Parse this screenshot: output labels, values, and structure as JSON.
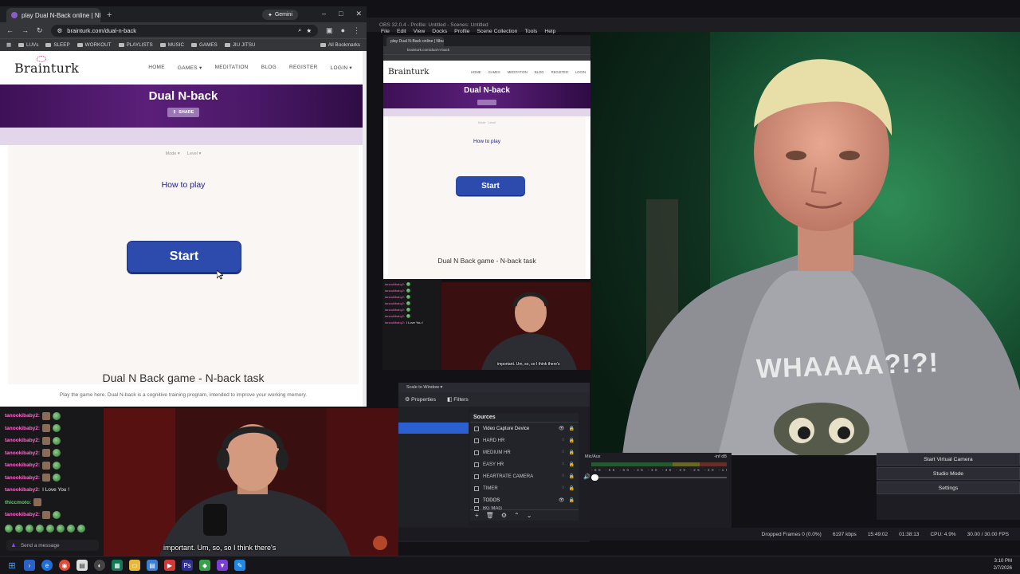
{
  "browser": {
    "tab_title": "play Dual N-Back online | Nbu",
    "gemini_label": "Gemini",
    "url": "brainturk.com/dual-n-back",
    "bookmarks": [
      "LUVs",
      "SLEEP",
      "WORKOUT",
      "PLAYLISTS",
      "MUSIC",
      "GAMES",
      "JIU JITSU"
    ],
    "all_bookmarks": "All Bookmarks"
  },
  "site": {
    "logo": "Brainturk",
    "nav": [
      "HOME",
      "GAMES",
      "MEDITATION",
      "BLOG",
      "REGISTER",
      "LOGIN"
    ],
    "title": "Dual N-back",
    "share": "SHARE",
    "mode_label": "Mode",
    "level_label": "Level",
    "how_to_play": "How to play",
    "start": "Start",
    "section_title": "Dual N Back game - N-back task",
    "section_text": "Play the game here. Dual N-back is a cognitive training program, intended to improve your working memory."
  },
  "preview": {
    "app_title": "OBS 32.0.4 - Profile: Untitled - Scenes: Untitled",
    "menu": [
      "File",
      "Edit",
      "View",
      "Docks",
      "Profile",
      "Scene Collection",
      "Tools",
      "Help"
    ],
    "tab_title": "play Dual N-Back online | Nbu",
    "url": "brainturk.com/dual-n-back",
    "logo": "Brainturk",
    "title": "Dual N-back",
    "how_to_play": "How to play",
    "start": "Start",
    "section_title": "Dual N Back game - N-back task"
  },
  "guest_subtitle": "important. Um, so, so I think there's",
  "streamer_shirt": "WHAAAA?!?!",
  "chat": {
    "messages": [
      {
        "user": "tanookibaby2:",
        "text": ""
      },
      {
        "user": "tanookibaby2:",
        "text": ""
      },
      {
        "user": "tanookibaby2:",
        "text": ""
      },
      {
        "user": "tanookibaby2:",
        "text": ""
      },
      {
        "user": "tanookibaby2:",
        "text": ""
      },
      {
        "user": "tanookibaby2:",
        "text": ""
      },
      {
        "user": "tanookibaby2:",
        "text": "I Love You !"
      },
      {
        "user": "thiccmoto:",
        "text": ""
      },
      {
        "user": "tanookibaby2:",
        "text": ""
      }
    ],
    "placeholder": "Send a message"
  },
  "obs": {
    "scale_label": "Scale to Window",
    "properties": "Properties",
    "filters": "Filters",
    "sources_title": "Sources",
    "sources": [
      "Video Capture Device",
      "HARD HR",
      "MEDIUM HR",
      "EASY HR",
      "HEARTRATE CAMERA",
      "TIMER",
      "TODOS",
      "BG MAG"
    ],
    "mixer_label": "Mic/Aux",
    "mixer_db": "-inf dB",
    "controls": [
      "Start Virtual Camera",
      "Studio Mode",
      "Settings"
    ],
    "status": {
      "dropped": "Dropped Frames 0 (0.0%)",
      "kbps": "6197 kbps",
      "rec_time": "15:49:02",
      "stream_time": "01:38:13",
      "cpu": "CPU: 4.9%",
      "fps": "30.00 / 30.00 FPS"
    }
  },
  "taskbar": {
    "time": "3:10 PM",
    "date": "2/7/2026"
  }
}
